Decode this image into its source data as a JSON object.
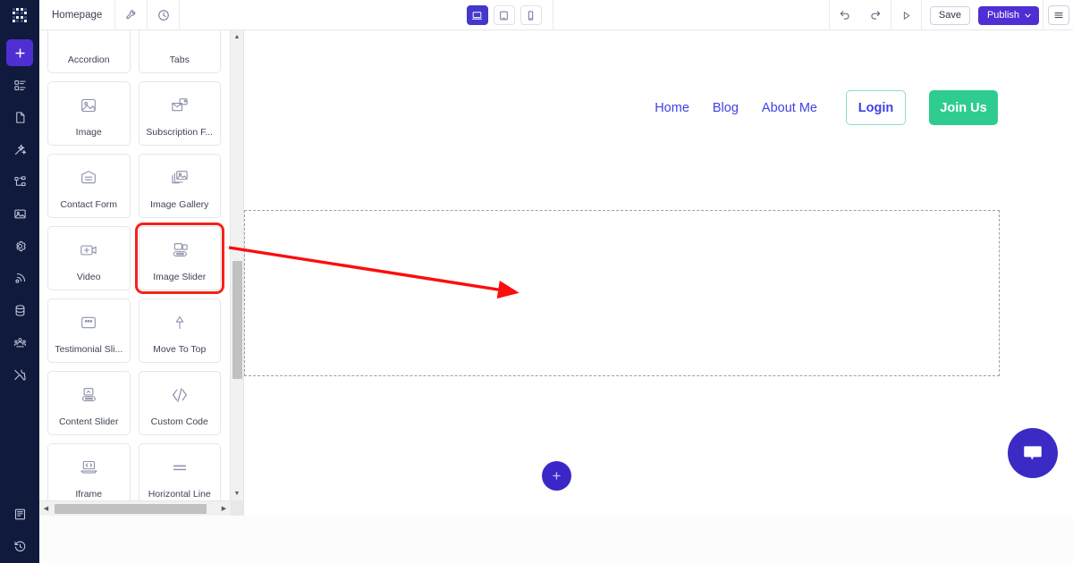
{
  "app": {
    "logo": "grid-logo",
    "accent_purple": "#4f2fd4",
    "rail_bg": "#101a3d",
    "highlight_red": "#f5221b"
  },
  "topbar": {
    "page_name": "Homepage",
    "tools": [
      {
        "name": "settings-wrench-icon",
        "title": "Settings"
      },
      {
        "name": "history-clock-icon",
        "title": "Revision History"
      }
    ],
    "devices": [
      {
        "name": "desktop-view-button",
        "label": "Desktop",
        "active": true
      },
      {
        "name": "tablet-view-button",
        "label": "Tablet",
        "active": false
      },
      {
        "name": "mobile-view-button",
        "label": "Mobile",
        "active": false
      }
    ],
    "undo_label": "Undo",
    "redo_label": "Redo",
    "preview_label": "Preview",
    "save_label": "Save",
    "publish_label": "Publish",
    "menu_label": "Menu"
  },
  "rail": {
    "items": [
      {
        "name": "add-element-button",
        "label": "Add",
        "icon": "plus-icon",
        "active": true
      },
      {
        "name": "rail-item-blocks",
        "label": "Blocks",
        "icon": "blocks-icon",
        "active": false
      },
      {
        "name": "rail-item-pages",
        "label": "Pages",
        "icon": "page-icon",
        "active": false
      },
      {
        "name": "rail-item-design",
        "label": "Design",
        "icon": "magic-wand-icon",
        "active": false
      },
      {
        "name": "rail-item-structure",
        "label": "Structure",
        "icon": "sitemap-icon",
        "active": false
      },
      {
        "name": "rail-item-media",
        "label": "Media",
        "icon": "image-icon",
        "active": false
      },
      {
        "name": "rail-item-settings",
        "label": "Settings",
        "icon": "gear-icon",
        "active": false
      },
      {
        "name": "rail-item-integrations",
        "label": "Integrations",
        "icon": "rss-icon",
        "active": false
      },
      {
        "name": "rail-item-database",
        "label": "Database",
        "icon": "database-icon",
        "active": false
      },
      {
        "name": "rail-item-members",
        "label": "Members",
        "icon": "users-icon",
        "active": false
      },
      {
        "name": "rail-item-tools",
        "label": "Tools",
        "icon": "tools-icon",
        "active": false
      }
    ],
    "bottom_items": [
      {
        "name": "rail-item-docs",
        "label": "Docs",
        "icon": "book-icon"
      },
      {
        "name": "rail-item-restore",
        "label": "Restore",
        "icon": "restore-clock-icon"
      }
    ]
  },
  "widget_panel": {
    "widgets": [
      {
        "name": "widget-accordion",
        "label": "Accordion",
        "icon": "accordion-icon",
        "clipped": true,
        "highlighted": false
      },
      {
        "name": "widget-tabs",
        "label": "Tabs",
        "icon": "tabs-icon",
        "clipped": true,
        "highlighted": false
      },
      {
        "name": "widget-image",
        "label": "Image",
        "icon": "image-icon",
        "clipped": false,
        "highlighted": false
      },
      {
        "name": "widget-subscription-form",
        "label": "Subscription F...",
        "icon": "subscription-form-icon",
        "clipped": false,
        "highlighted": false
      },
      {
        "name": "widget-contact-form",
        "label": "Contact Form",
        "icon": "envelope-icon",
        "clipped": false,
        "highlighted": false
      },
      {
        "name": "widget-image-gallery",
        "label": "Image Gallery",
        "icon": "image-gallery-icon",
        "clipped": false,
        "highlighted": false
      },
      {
        "name": "widget-video",
        "label": "Video",
        "icon": "video-camera-icon",
        "clipped": false,
        "highlighted": false
      },
      {
        "name": "widget-image-slider",
        "label": "Image Slider",
        "icon": "image-slider-icon",
        "clipped": false,
        "highlighted": true
      },
      {
        "name": "widget-testimonial-slider",
        "label": "Testimonial Sli...",
        "icon": "testimonial-icon",
        "clipped": false,
        "highlighted": false
      },
      {
        "name": "widget-move-to-top",
        "label": "Move To Top",
        "icon": "arrow-up-icon",
        "clipped": false,
        "highlighted": false
      },
      {
        "name": "widget-content-slider",
        "label": "Content Slider",
        "icon": "content-slider-icon",
        "clipped": false,
        "highlighted": false
      },
      {
        "name": "widget-custom-code",
        "label": "Custom Code",
        "icon": "code-icon",
        "clipped": false,
        "highlighted": false
      },
      {
        "name": "widget-iframe",
        "label": "Iframe",
        "icon": "iframe-icon",
        "clipped": false,
        "highlighted": false
      },
      {
        "name": "widget-horizontal-line",
        "label": "Horizontal Line",
        "icon": "horizontal-line-icon",
        "clipped": false,
        "highlighted": false
      }
    ],
    "scroll_up_label": "Scroll up",
    "scroll_down_label": "Scroll down",
    "scroll_left_label": "Scroll left",
    "scroll_right_label": "Scroll right"
  },
  "canvas": {
    "nav_links": [
      {
        "name": "site-nav-home",
        "label": "Home"
      },
      {
        "name": "site-nav-blog",
        "label": "Blog"
      },
      {
        "name": "site-nav-about-me",
        "label": "About Me"
      }
    ],
    "login_label": "Login",
    "join_label": "Join Us",
    "add_section_label": "+",
    "chat_label": "Chat support",
    "link_color": "#4040e8",
    "join_color": "#2ecc8f"
  },
  "annotation": {
    "type": "arrow",
    "color": "#fc0d0d",
    "from": "Image Slider widget card",
    "to": "Add element button on canvas"
  }
}
